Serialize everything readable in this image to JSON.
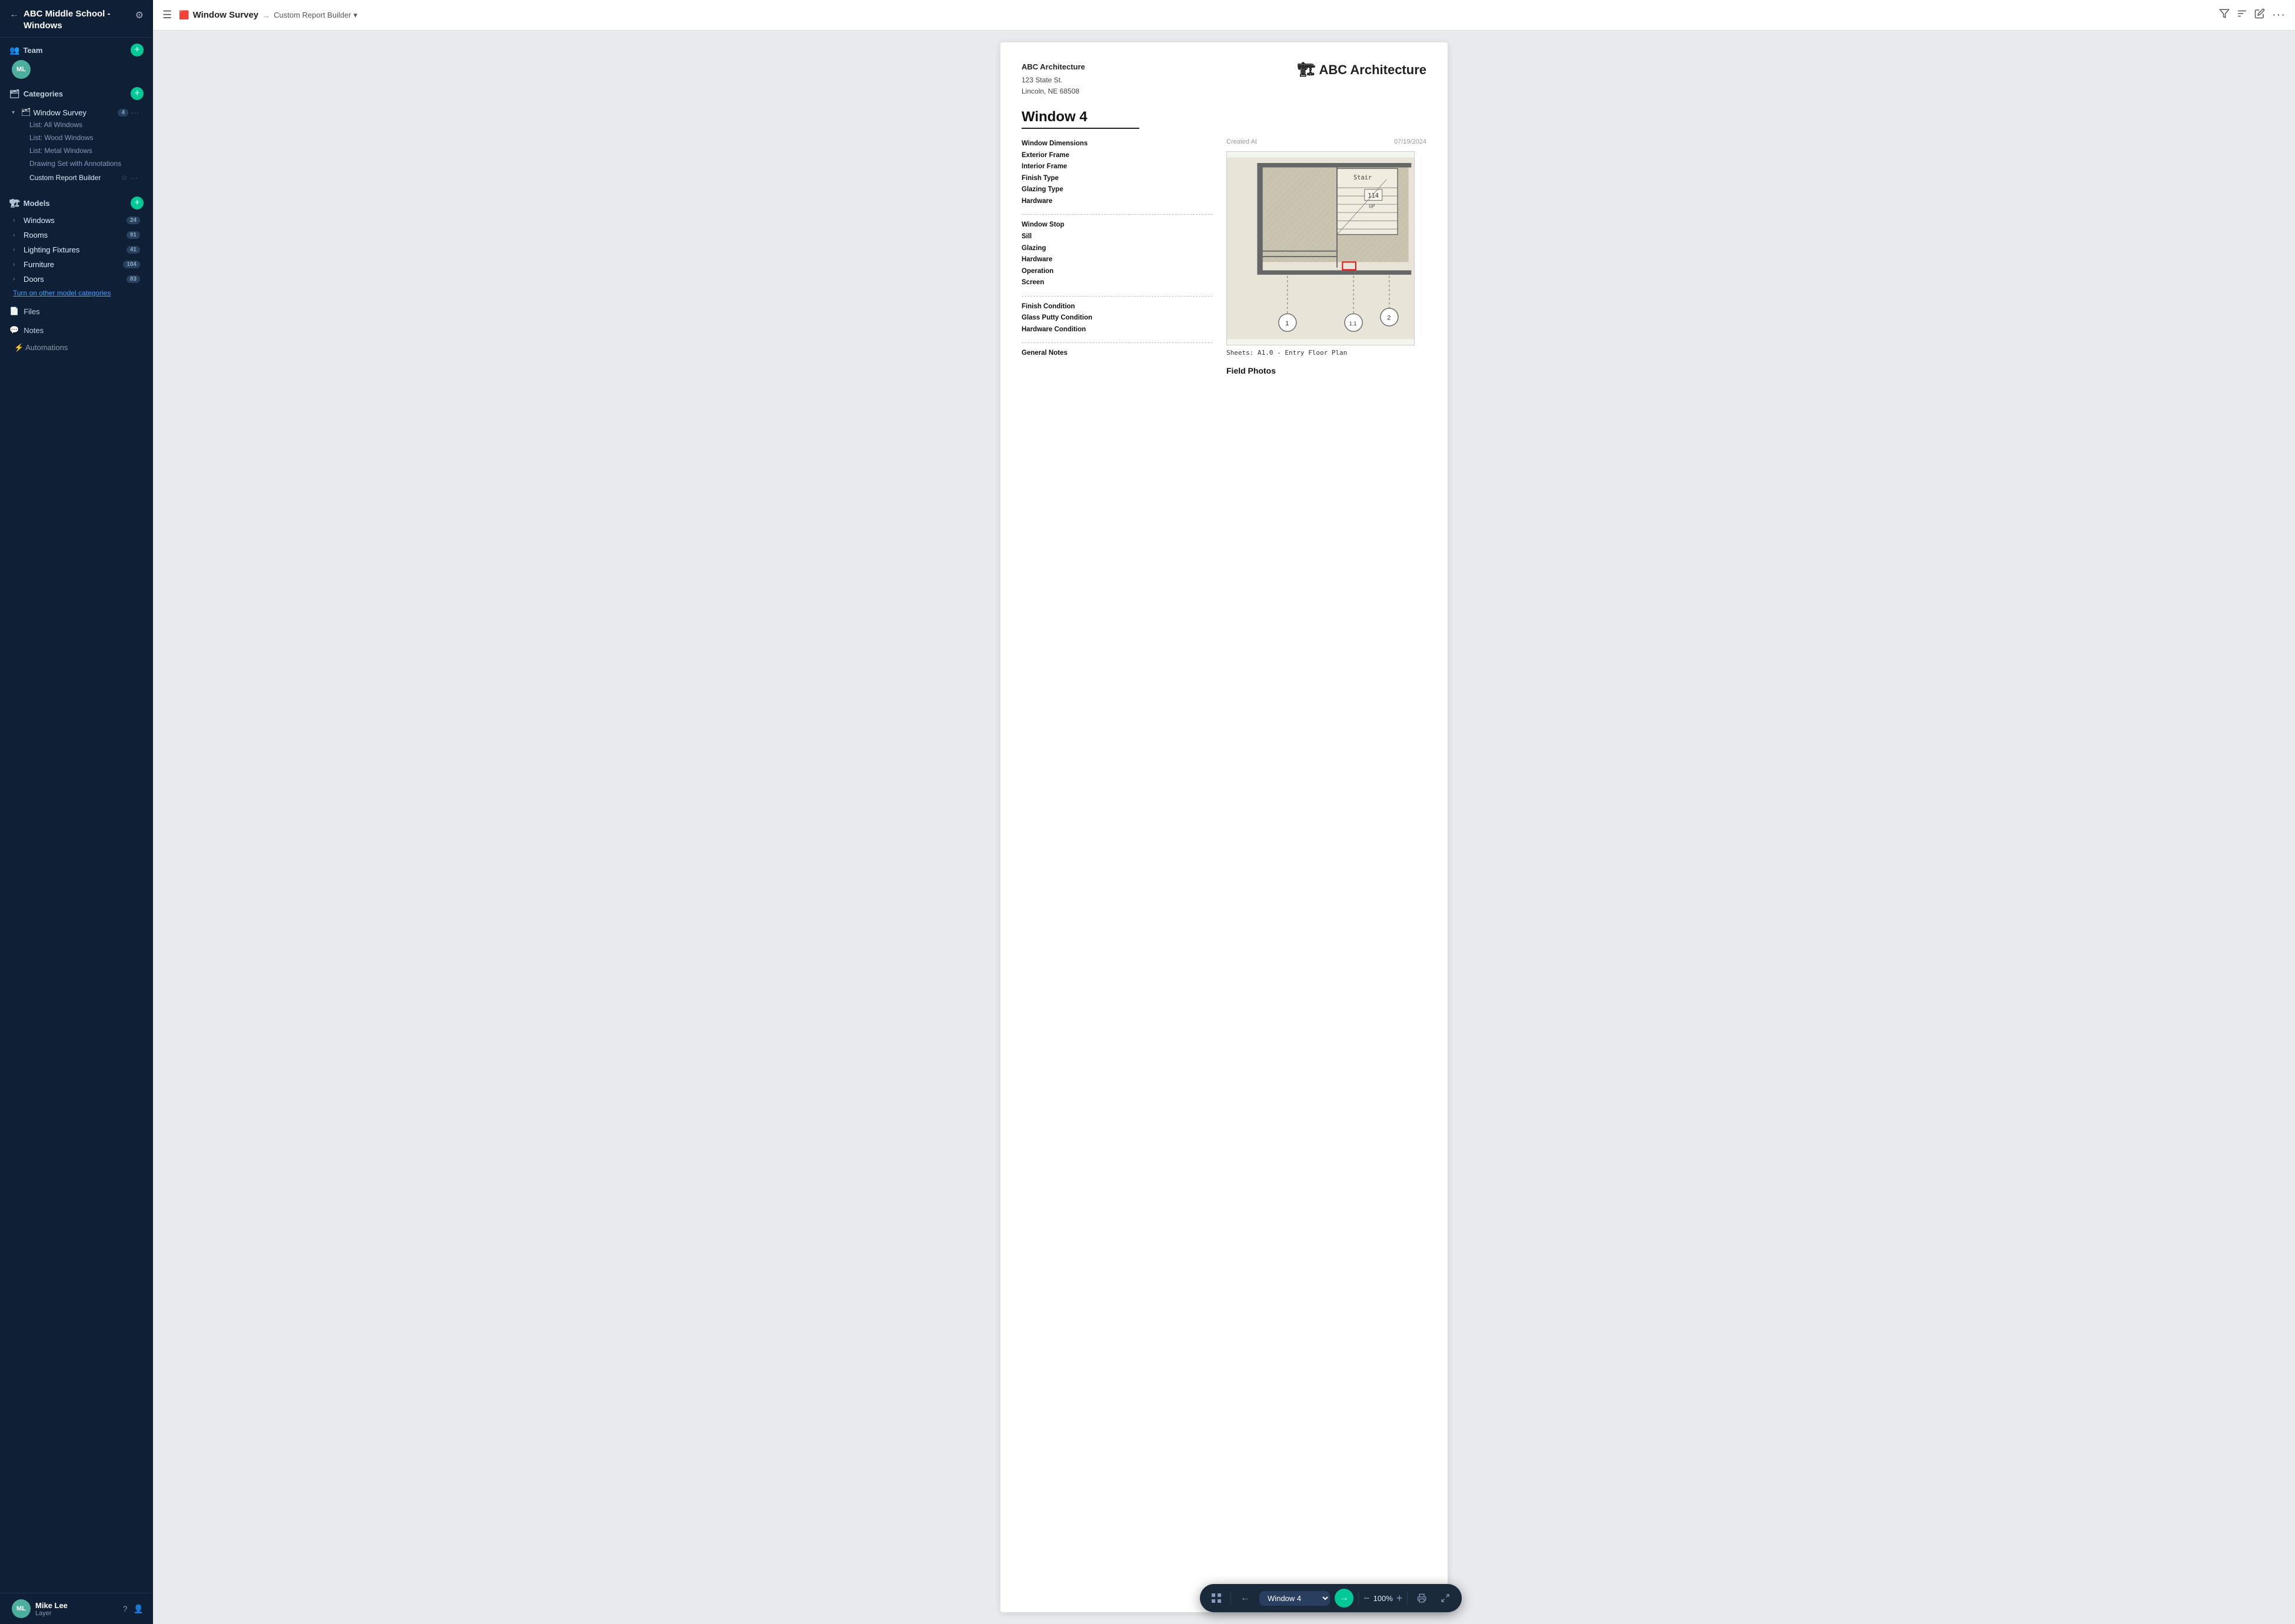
{
  "sidebar": {
    "project_title": "ABC Middle School - Windows",
    "back_label": "←",
    "gear_label": "⚙",
    "team": {
      "label": "Team",
      "add_label": "+",
      "members": [
        {
          "initials": "ML",
          "color": "#4caf9e"
        }
      ]
    },
    "categories": {
      "label": "Categories",
      "add_label": "+",
      "items": [
        {
          "name": "Window Survey",
          "badge": "4",
          "expanded": true,
          "icon": "🗂",
          "subitems": [
            {
              "label": "List: All Windows",
              "active": false
            },
            {
              "label": "List: Wood Windows",
              "active": false
            },
            {
              "label": "List: Metal Windows",
              "active": false
            },
            {
              "label": "Drawing Set with Annotations",
              "active": false
            }
          ],
          "custom_report": "Custom Report Builder"
        }
      ]
    },
    "models": {
      "label": "Models",
      "add_label": "+",
      "items": [
        {
          "name": "Windows",
          "badge": "24"
        },
        {
          "name": "Rooms",
          "badge": "91"
        },
        {
          "name": "Lighting Fixtures",
          "badge": "41"
        },
        {
          "name": "Furniture",
          "badge": "104"
        },
        {
          "name": "Doors",
          "badge": "83"
        }
      ],
      "turn_on_label": "Turn on other model categories"
    },
    "files_label": "Files",
    "notes_label": "Notes",
    "automations_label": "Automations",
    "user": {
      "initials": "ML",
      "name": "Mike Lee",
      "role": "Layer",
      "color": "#4caf9e"
    },
    "help_icon": "?",
    "person_icon": "👤"
  },
  "topbar": {
    "menu_icon": "☰",
    "breadcrumb_icon": "🟥",
    "survey_title": "Window Survey",
    "arrow": "→",
    "sub_label": "Custom Report Builder",
    "dropdown_icon": "▾",
    "filter_icon": "filter",
    "sort_icon": "sort",
    "edit_icon": "edit",
    "more_icon": "···"
  },
  "report": {
    "company_name": "ABC Architecture",
    "company_address_line1": "123 State St.",
    "company_address_line2": "Lincoln, NE 68508",
    "logo_text": "ABC Architecture",
    "logo_icon": "🏗",
    "window_title": "Window 4",
    "created_at_label": "Created At",
    "created_at_value": "07/19/2024",
    "field_groups": [
      {
        "fields": [
          "Window Dimensions",
          "Exterior Frame",
          "Interior Frame",
          "Finish Type",
          "Glazing Type",
          "Hardware"
        ]
      },
      {
        "fields": [
          "Window Stop",
          "Sill",
          "Glazing",
          "Hardware",
          "Operation",
          "Screen"
        ]
      },
      {
        "fields": [
          "Finish Condition",
          "Glass Putty Condition",
          "Hardware Condition"
        ]
      },
      {
        "fields": [
          "General Notes"
        ]
      }
    ],
    "sheets_label": "Sheets: A1.0 - Entry Floor Plan",
    "field_photos_label": "Field Photos"
  },
  "bottom_nav": {
    "grid_icon": "⠿",
    "prev_icon": "←",
    "next_icon": "→",
    "window_label": "Window 4",
    "dropdown_icon": "▾",
    "zoom_label": "100%",
    "zoom_in_icon": "+",
    "zoom_out_icon": "−",
    "print_icon": "🖨",
    "expand_icon": "⤢"
  }
}
